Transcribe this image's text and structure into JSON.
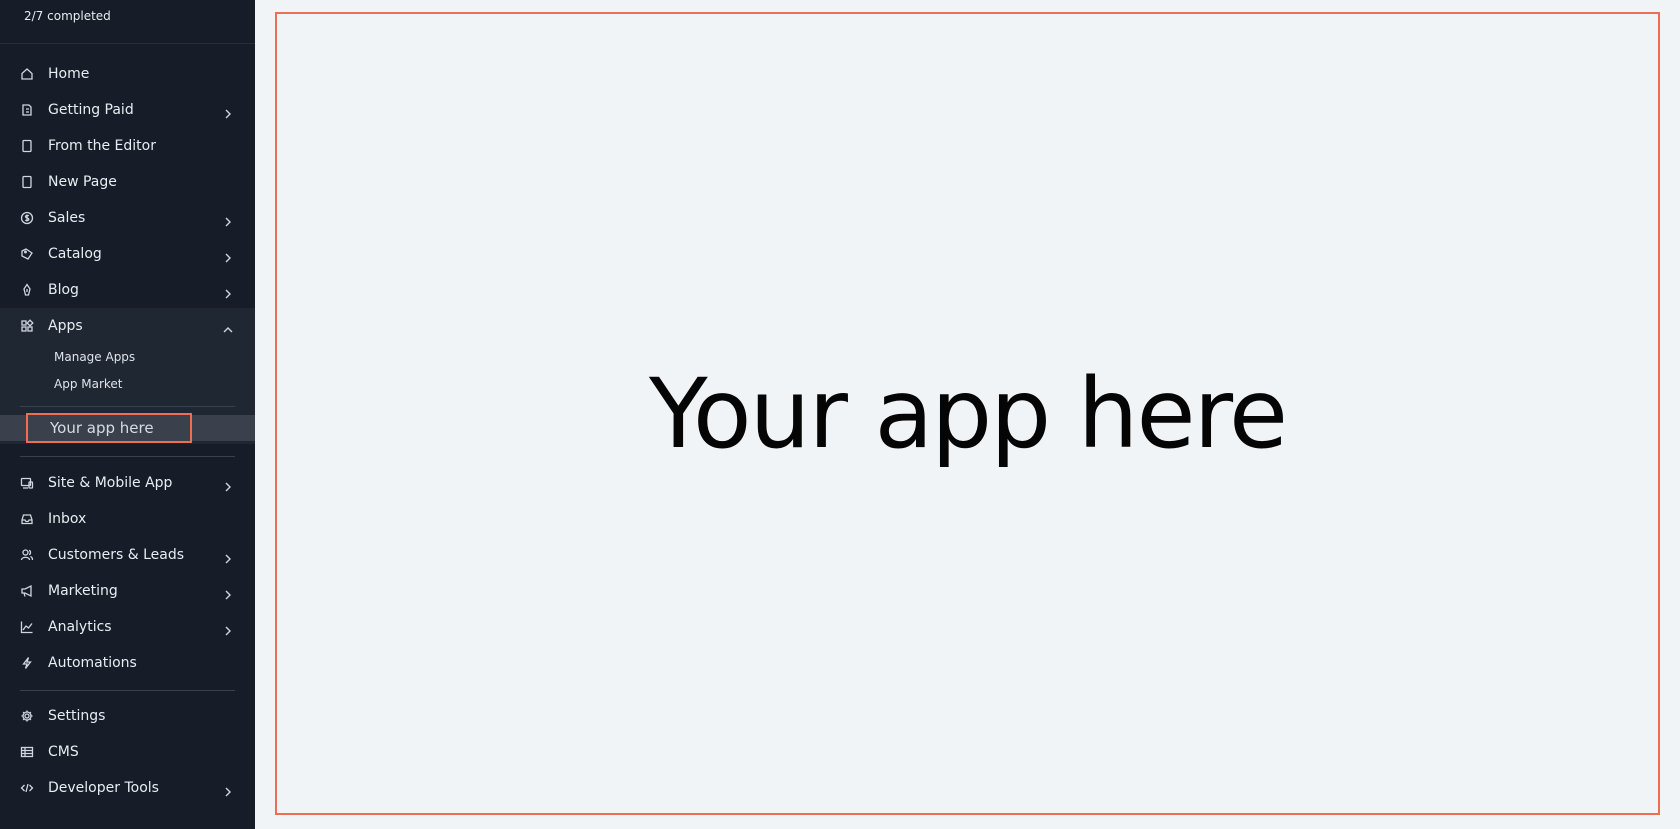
{
  "sidebar": {
    "progress": "2/7 completed",
    "items": [
      {
        "id": "home",
        "label": "Home",
        "icon": "home-icon",
        "chevron": false
      },
      {
        "id": "getting-paid",
        "label": "Getting Paid",
        "icon": "payment-icon",
        "chevron": true
      },
      {
        "id": "from-editor",
        "label": "From the Editor",
        "icon": "page-icon",
        "chevron": false
      },
      {
        "id": "new-page",
        "label": "New Page",
        "icon": "page-icon",
        "chevron": false
      },
      {
        "id": "sales",
        "label": "Sales",
        "icon": "dollar-icon",
        "chevron": true
      },
      {
        "id": "catalog",
        "label": "Catalog",
        "icon": "tag-icon",
        "chevron": true
      },
      {
        "id": "blog",
        "label": "Blog",
        "icon": "pen-icon",
        "chevron": true
      },
      {
        "id": "apps",
        "label": "Apps",
        "icon": "apps-icon",
        "chevron": true,
        "expanded": true
      }
    ],
    "apps_sub": [
      {
        "label": "Manage Apps"
      },
      {
        "label": "App Market"
      }
    ],
    "your_app": "Your app here",
    "items2": [
      {
        "id": "site-mobile",
        "label": "Site & Mobile App",
        "icon": "devices-icon",
        "chevron": true
      },
      {
        "id": "inbox",
        "label": "Inbox",
        "icon": "inbox-icon",
        "chevron": false
      },
      {
        "id": "customers",
        "label": "Customers & Leads",
        "icon": "people-icon",
        "chevron": true
      },
      {
        "id": "marketing",
        "label": "Marketing",
        "icon": "megaphone-icon",
        "chevron": true
      },
      {
        "id": "analytics",
        "label": "Analytics",
        "icon": "chart-icon",
        "chevron": true
      },
      {
        "id": "automations",
        "label": "Automations",
        "icon": "bolt-icon",
        "chevron": false
      }
    ],
    "items3": [
      {
        "id": "settings",
        "label": "Settings",
        "icon": "gear-icon",
        "chevron": false
      },
      {
        "id": "cms",
        "label": "CMS",
        "icon": "table-icon",
        "chevron": false
      },
      {
        "id": "developer-tools",
        "label": "Developer Tools",
        "icon": "code-icon",
        "chevron": true
      }
    ]
  },
  "main": {
    "title": "Your app here"
  },
  "colors": {
    "sidebar_bg": "#161d28",
    "highlight_border": "#ee6d55",
    "canvas_bg": "#f1f4f7"
  }
}
